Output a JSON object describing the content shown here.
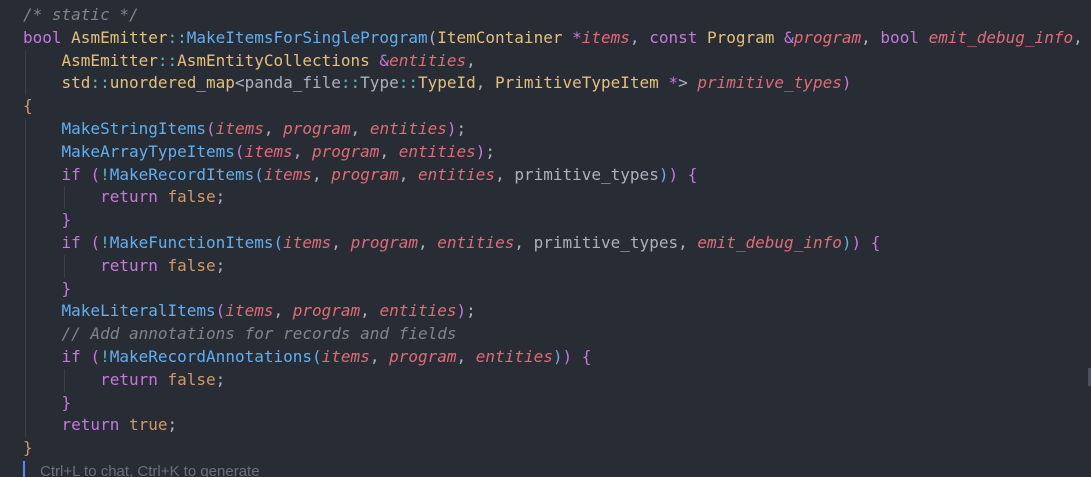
{
  "editor": {
    "lines": [
      {
        "indent": 0,
        "tokens": [
          {
            "t": "/* static */",
            "k": "comment"
          }
        ]
      },
      {
        "indent": 0,
        "tokens": [
          {
            "t": "bool",
            "k": "keyword"
          },
          {
            "t": " ",
            "k": "plain"
          },
          {
            "t": "AsmEmitter",
            "k": "type"
          },
          {
            "t": "::",
            "k": "op"
          },
          {
            "t": "MakeItemsForSingleProgram",
            "k": "func"
          },
          {
            "t": "(",
            "k": "plain"
          },
          {
            "t": "ItemContainer",
            "k": "type"
          },
          {
            "t": " ",
            "k": "plain"
          },
          {
            "t": "*",
            "k": "keyword"
          },
          {
            "t": "items",
            "k": "param"
          },
          {
            "t": ", ",
            "k": "plain"
          },
          {
            "t": "const",
            "k": "keyword"
          },
          {
            "t": " ",
            "k": "plain"
          },
          {
            "t": "Program",
            "k": "type"
          },
          {
            "t": " ",
            "k": "plain"
          },
          {
            "t": "&",
            "k": "keyword"
          },
          {
            "t": "program",
            "k": "param"
          },
          {
            "t": ", ",
            "k": "plain"
          },
          {
            "t": "bool",
            "k": "keyword"
          },
          {
            "t": " ",
            "k": "plain"
          },
          {
            "t": "emit_debug_info",
            "k": "param"
          },
          {
            "t": ",",
            "k": "plain"
          }
        ]
      },
      {
        "indent": 1,
        "tokens": [
          {
            "t": "AsmEmitter",
            "k": "type"
          },
          {
            "t": "::",
            "k": "op"
          },
          {
            "t": "AsmEntityCollections",
            "k": "type"
          },
          {
            "t": " ",
            "k": "plain"
          },
          {
            "t": "&",
            "k": "keyword"
          },
          {
            "t": "entities",
            "k": "param"
          },
          {
            "t": ",",
            "k": "plain"
          }
        ]
      },
      {
        "indent": 1,
        "tokens": [
          {
            "t": "std",
            "k": "type"
          },
          {
            "t": "::",
            "k": "op"
          },
          {
            "t": "unordered_map",
            "k": "type"
          },
          {
            "t": "<",
            "k": "plain"
          },
          {
            "t": "panda_file",
            "k": "plain"
          },
          {
            "t": "::",
            "k": "op"
          },
          {
            "t": "Type",
            "k": "plain"
          },
          {
            "t": "::",
            "k": "op"
          },
          {
            "t": "TypeId",
            "k": "type"
          },
          {
            "t": ", ",
            "k": "plain"
          },
          {
            "t": "PrimitiveTypeItem",
            "k": "type"
          },
          {
            "t": " ",
            "k": "plain"
          },
          {
            "t": "*",
            "k": "keyword"
          },
          {
            "t": "> ",
            "k": "plain"
          },
          {
            "t": "primitive_types",
            "k": "param"
          },
          {
            "t": ")",
            "k": "keyword"
          }
        ]
      },
      {
        "indent": 0,
        "tokens": [
          {
            "t": "{",
            "k": "brace"
          }
        ]
      },
      {
        "indent": 1,
        "tokens": [
          {
            "t": "MakeStringItems",
            "k": "func"
          },
          {
            "t": "(",
            "k": "brace2"
          },
          {
            "t": "items",
            "k": "param"
          },
          {
            "t": ", ",
            "k": "plain"
          },
          {
            "t": "program",
            "k": "param"
          },
          {
            "t": ", ",
            "k": "plain"
          },
          {
            "t": "entities",
            "k": "param"
          },
          {
            "t": ")",
            "k": "brace2"
          },
          {
            "t": ";",
            "k": "plain"
          }
        ]
      },
      {
        "indent": 1,
        "tokens": [
          {
            "t": "MakeArrayTypeItems",
            "k": "func"
          },
          {
            "t": "(",
            "k": "brace2"
          },
          {
            "t": "items",
            "k": "param"
          },
          {
            "t": ", ",
            "k": "plain"
          },
          {
            "t": "program",
            "k": "param"
          },
          {
            "t": ", ",
            "k": "plain"
          },
          {
            "t": "entities",
            "k": "param"
          },
          {
            "t": ")",
            "k": "brace2"
          },
          {
            "t": ";",
            "k": "plain"
          }
        ]
      },
      {
        "indent": 1,
        "tokens": [
          {
            "t": "if",
            "k": "keyword"
          },
          {
            "t": " ",
            "k": "plain"
          },
          {
            "t": "(",
            "k": "brace2"
          },
          {
            "t": "!",
            "k": "op"
          },
          {
            "t": "MakeRecordItems",
            "k": "func"
          },
          {
            "t": "(",
            "k": "brace3"
          },
          {
            "t": "items",
            "k": "param"
          },
          {
            "t": ", ",
            "k": "plain"
          },
          {
            "t": "program",
            "k": "param"
          },
          {
            "t": ", ",
            "k": "plain"
          },
          {
            "t": "entities",
            "k": "param"
          },
          {
            "t": ", ",
            "k": "plain"
          },
          {
            "t": "primitive_types",
            "k": "plain"
          },
          {
            "t": ")",
            "k": "brace3"
          },
          {
            "t": ")",
            "k": "brace2"
          },
          {
            "t": " ",
            "k": "plain"
          },
          {
            "t": "{",
            "k": "brace2"
          }
        ]
      },
      {
        "indent": 2,
        "tokens": [
          {
            "t": "return",
            "k": "keyword"
          },
          {
            "t": " ",
            "k": "plain"
          },
          {
            "t": "false",
            "k": "const"
          },
          {
            "t": ";",
            "k": "plain"
          }
        ]
      },
      {
        "indent": 1,
        "tokens": [
          {
            "t": "}",
            "k": "brace2"
          }
        ]
      },
      {
        "indent": 1,
        "tokens": [
          {
            "t": "if",
            "k": "keyword"
          },
          {
            "t": " ",
            "k": "plain"
          },
          {
            "t": "(",
            "k": "brace2"
          },
          {
            "t": "!",
            "k": "op"
          },
          {
            "t": "MakeFunctionItems",
            "k": "func"
          },
          {
            "t": "(",
            "k": "brace3"
          },
          {
            "t": "items",
            "k": "param"
          },
          {
            "t": ", ",
            "k": "plain"
          },
          {
            "t": "program",
            "k": "param"
          },
          {
            "t": ", ",
            "k": "plain"
          },
          {
            "t": "entities",
            "k": "param"
          },
          {
            "t": ", ",
            "k": "plain"
          },
          {
            "t": "primitive_types",
            "k": "plain"
          },
          {
            "t": ", ",
            "k": "plain"
          },
          {
            "t": "emit_debug_info",
            "k": "param"
          },
          {
            "t": ")",
            "k": "brace3"
          },
          {
            "t": ")",
            "k": "brace2"
          },
          {
            "t": " ",
            "k": "plain"
          },
          {
            "t": "{",
            "k": "brace2"
          }
        ]
      },
      {
        "indent": 2,
        "tokens": [
          {
            "t": "return",
            "k": "keyword"
          },
          {
            "t": " ",
            "k": "plain"
          },
          {
            "t": "false",
            "k": "const"
          },
          {
            "t": ";",
            "k": "plain"
          }
        ]
      },
      {
        "indent": 1,
        "tokens": [
          {
            "t": "}",
            "k": "brace2"
          }
        ]
      },
      {
        "indent": 1,
        "tokens": [
          {
            "t": "MakeLiteralItems",
            "k": "func"
          },
          {
            "t": "(",
            "k": "brace2"
          },
          {
            "t": "items",
            "k": "param"
          },
          {
            "t": ", ",
            "k": "plain"
          },
          {
            "t": "program",
            "k": "param"
          },
          {
            "t": ", ",
            "k": "plain"
          },
          {
            "t": "entities",
            "k": "param"
          },
          {
            "t": ")",
            "k": "brace2"
          },
          {
            "t": ";",
            "k": "plain"
          }
        ]
      },
      {
        "indent": 1,
        "tokens": [
          {
            "t": "// Add annotations for records and fields",
            "k": "comment"
          }
        ]
      },
      {
        "indent": 1,
        "tokens": [
          {
            "t": "if",
            "k": "keyword"
          },
          {
            "t": " ",
            "k": "plain"
          },
          {
            "t": "(",
            "k": "brace2"
          },
          {
            "t": "!",
            "k": "op"
          },
          {
            "t": "MakeRecordAnnotations",
            "k": "func"
          },
          {
            "t": "(",
            "k": "brace3"
          },
          {
            "t": "items",
            "k": "param"
          },
          {
            "t": ", ",
            "k": "plain"
          },
          {
            "t": "program",
            "k": "param"
          },
          {
            "t": ", ",
            "k": "plain"
          },
          {
            "t": "entities",
            "k": "param"
          },
          {
            "t": ")",
            "k": "brace3"
          },
          {
            "t": ")",
            "k": "brace2"
          },
          {
            "t": " ",
            "k": "plain"
          },
          {
            "t": "{",
            "k": "brace2"
          }
        ]
      },
      {
        "indent": 2,
        "tokens": [
          {
            "t": "return",
            "k": "keyword"
          },
          {
            "t": " ",
            "k": "plain"
          },
          {
            "t": "false",
            "k": "const"
          },
          {
            "t": ";",
            "k": "plain"
          }
        ]
      },
      {
        "indent": 1,
        "tokens": [
          {
            "t": "}",
            "k": "brace2"
          }
        ]
      },
      {
        "indent": 1,
        "tokens": [
          {
            "t": "return",
            "k": "keyword"
          },
          {
            "t": " ",
            "k": "plain"
          },
          {
            "t": "true",
            "k": "const"
          },
          {
            "t": ";",
            "k": "plain"
          }
        ]
      },
      {
        "indent": 0,
        "tokens": [
          {
            "t": "}",
            "k": "brace"
          }
        ]
      }
    ]
  },
  "hint": {
    "text": "Ctrl+L to chat, Ctrl+K to generate"
  },
  "colors": {
    "background": "#282c34",
    "comment": "#7f848e",
    "keyword": "#c678dd",
    "type": "#e5c07b",
    "function": "#61afef",
    "parameter": "#e06c75",
    "plain": "#abb2bf",
    "operator": "#56b6c2",
    "constant": "#d19a66",
    "cursor": "#528bff"
  }
}
